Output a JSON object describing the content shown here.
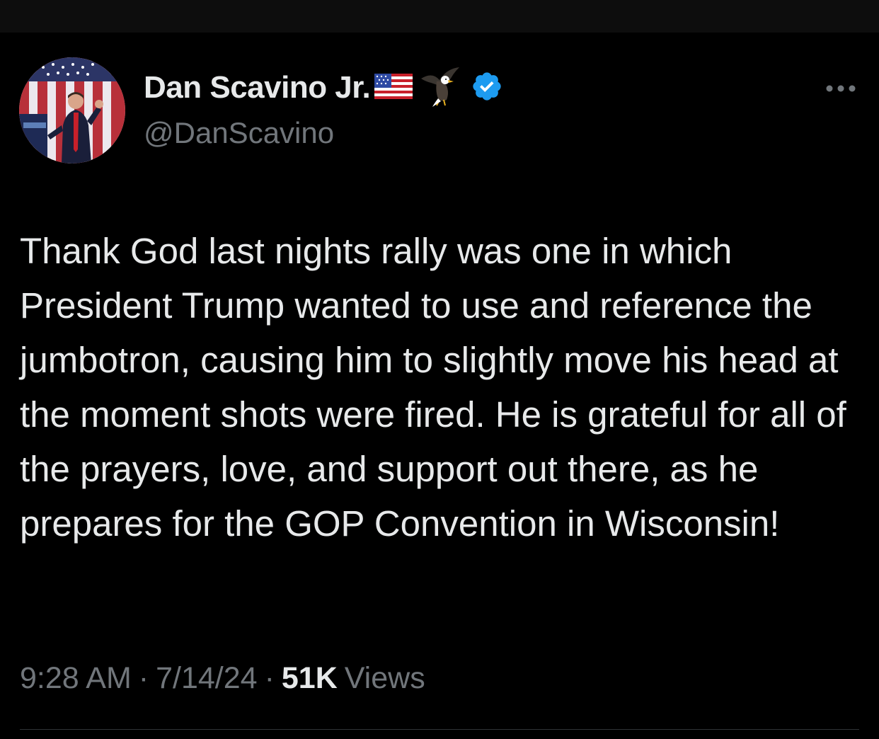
{
  "tweet": {
    "author": {
      "display_name": "Dan Scavino Jr.",
      "handle": "@DanScavino",
      "verified": true,
      "name_emojis": [
        "us-flag-icon",
        "eagle-icon"
      ]
    },
    "text": "Thank God last nights rally was one in which President Trump wanted to use and reference the jumbotron, causing him to slightly move his head at the moment shots were fired. He is grateful for all of the prayers, love, and support out there, as he prepares for the GOP Convention in Wisconsin!",
    "time": "9:28 AM",
    "date": "7/14/24",
    "separator": "·",
    "views_count": "51K",
    "views_label": "Views"
  },
  "colors": {
    "background": "#000000",
    "primary_text": "#e7e9ea",
    "secondary_text": "#71767b",
    "verified_badge": "#1d9bf0",
    "divider": "#2f3336"
  },
  "icons": {
    "more": "more-dots-icon",
    "verified": "verified-badge-icon"
  }
}
